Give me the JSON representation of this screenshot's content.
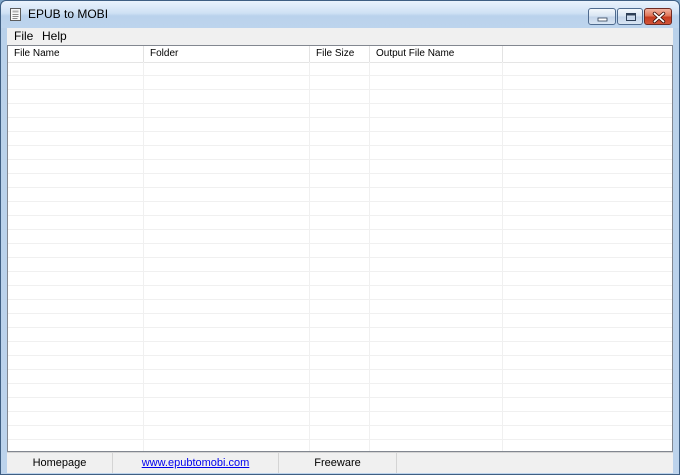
{
  "window": {
    "title": "EPUB to MOBI",
    "controls": [
      "minimize-icon",
      "maximize-icon",
      "close-icon"
    ]
  },
  "menu": {
    "items": [
      "File",
      "Help"
    ]
  },
  "list": {
    "columns": [
      "File Name",
      "Folder",
      "File Size",
      "Output File Name"
    ],
    "rows": []
  },
  "status": {
    "homepage_label": "Homepage",
    "link": "www.epubtomobi.com",
    "license": "Freeware"
  }
}
